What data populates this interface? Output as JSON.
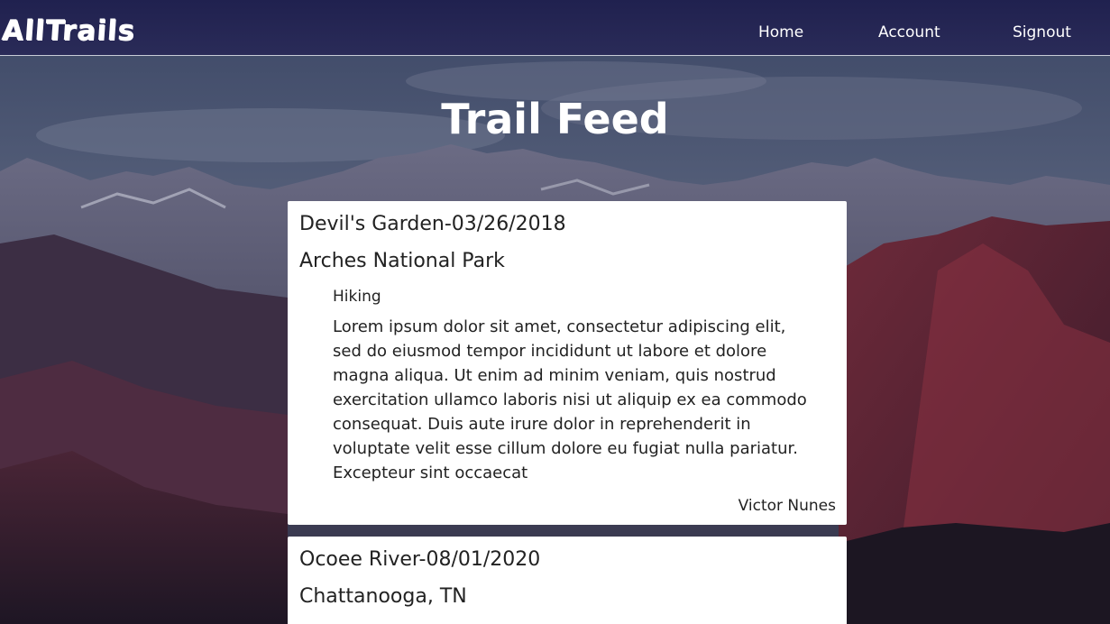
{
  "nav": {
    "logo": "AllTrails",
    "links": [
      "Home",
      "Account",
      "Signout"
    ]
  },
  "feed": {
    "title": "Trail Feed",
    "posts": [
      {
        "title": "Devil's Garden-03/26/2018",
        "location": "Arches National Park",
        "activity": "Hiking",
        "description": "Lorem ipsum dolor sit amet, consectetur adipiscing elit, sed do eiusmod tempor incididunt ut labore et dolore magna aliqua. Ut enim ad minim veniam, quis nostrud exercitation ullamco laboris nisi ut aliquip ex ea commodo consequat. Duis aute irure dolor in reprehenderit in voluptate velit esse cillum dolore eu fugiat nulla pariatur. Excepteur sint occaecat",
        "author": "Victor Nunes"
      },
      {
        "title": "Ocoee River-08/01/2020",
        "location": "Chattanooga, TN"
      }
    ]
  },
  "colors": {
    "navbar": "#20214f",
    "card": "#ffffff",
    "text": "#222222"
  }
}
